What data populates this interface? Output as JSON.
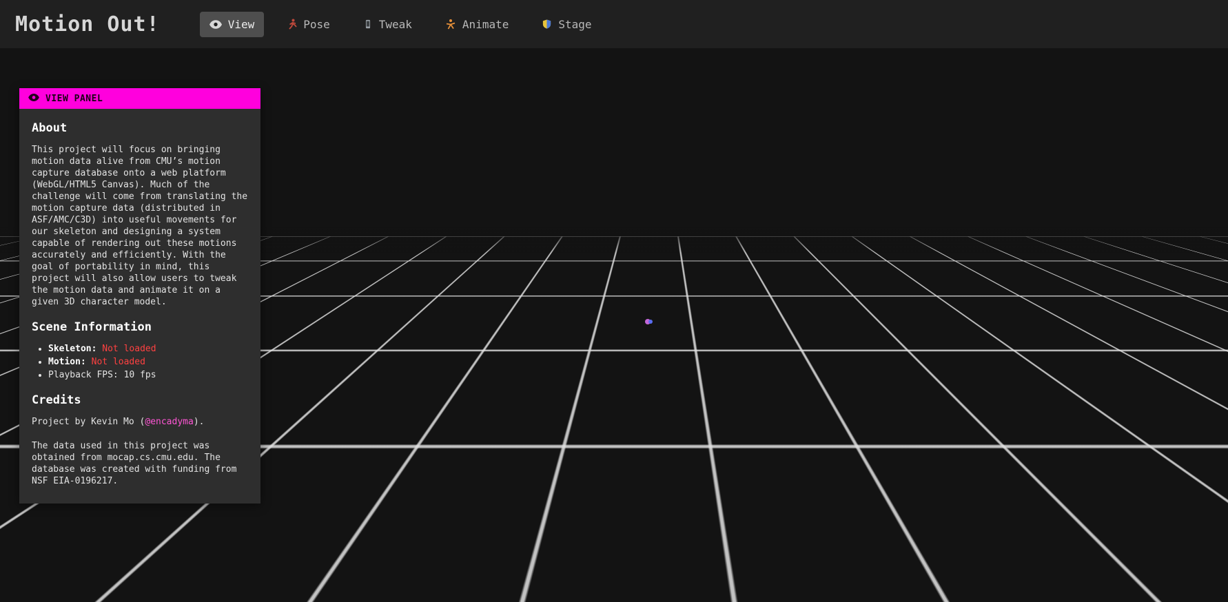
{
  "app": {
    "title": "Motion Out!"
  },
  "nav": {
    "tabs": [
      {
        "label": "View",
        "icon": "eye-icon",
        "active": true
      },
      {
        "label": "Pose",
        "icon": "runner-icon",
        "active": false
      },
      {
        "label": "Tweak",
        "icon": "phone-icon",
        "active": false
      },
      {
        "label": "Animate",
        "icon": "acrobat-icon",
        "active": false
      },
      {
        "label": "Stage",
        "icon": "shield-icon",
        "active": false
      }
    ]
  },
  "panel": {
    "header": {
      "icon": "eye-icon",
      "title": "VIEW PANEL"
    },
    "about": {
      "title": "About",
      "body": "This project will focus on bringing motion data alive from CMU’s motion capture database onto a web platform (WebGL/HTML5 Canvas). Much of the challenge will come from translating the motion capture data (distributed in ASF/AMC/C3D) into useful movements for our skeleton and designing a system capable of rendering out these motions accurately and efficiently. With the goal of portability in mind, this project will also allow users to tweak the motion data and animate it on a given 3D character model."
    },
    "scene_info": {
      "title": "Scene Information",
      "items": [
        {
          "label": "Skeleton:",
          "value": "Not loaded",
          "status": "error"
        },
        {
          "label": "Motion:",
          "value": "Not loaded",
          "status": "error"
        },
        {
          "label": "Playback FPS:",
          "value": "10 fps",
          "status": "normal"
        }
      ]
    },
    "credits": {
      "title": "Credits",
      "line1_pre": "Project by Kevin Mo (",
      "link": "@encadyma",
      "line1_post": ").",
      "line2": "The data used in this project was obtained from mocap.cs.cmu.edu. The database was created with funding from NSF EIA-0196217."
    }
  },
  "scene": {
    "origin_marker": "origin-marker"
  },
  "colors": {
    "header_bg": "#ff00dd",
    "link": "#ff55d5",
    "error": "#ff4141",
    "active_tab_bg": "#4e4e4e",
    "marker_purple": "#c467d8",
    "marker_blue": "#5a6cf0"
  }
}
